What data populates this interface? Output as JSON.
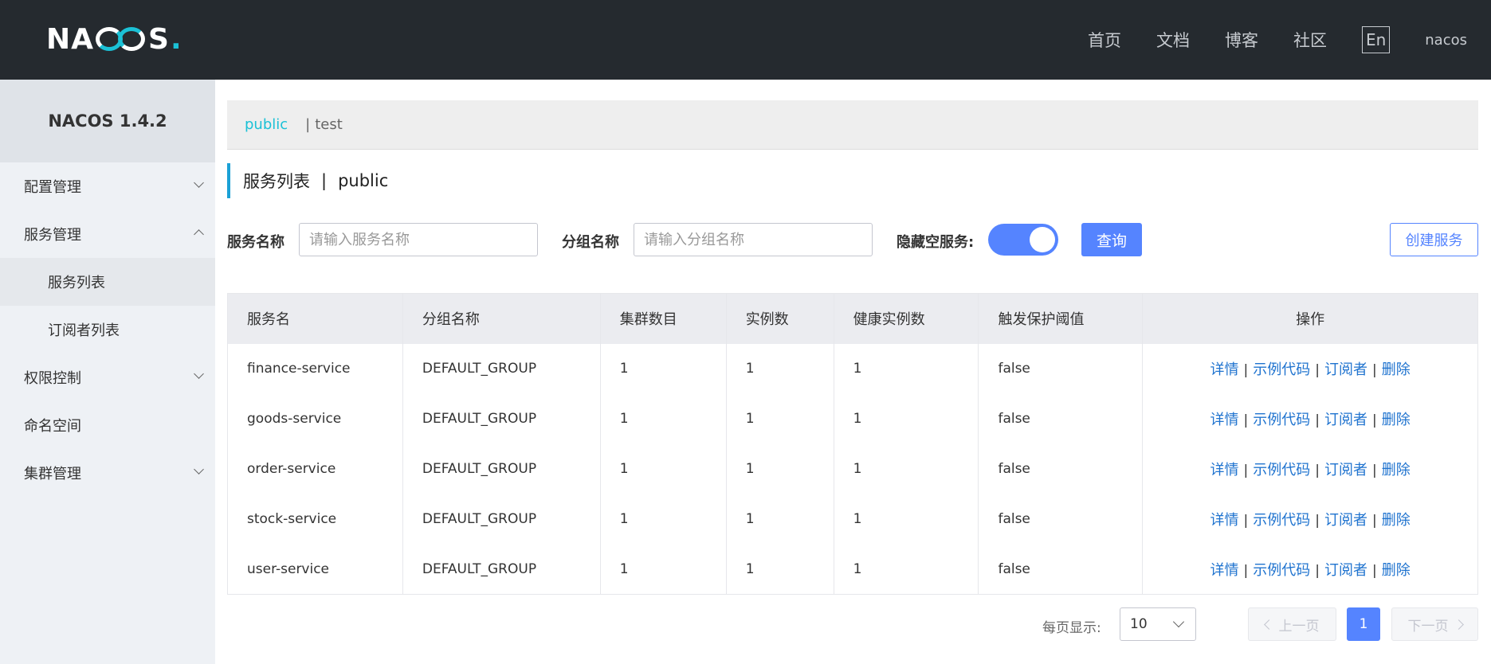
{
  "header": {
    "logo_left": "NA",
    "logo_right": "S",
    "logo_dot": ".",
    "nav": [
      "首页",
      "文档",
      "博客",
      "社区"
    ],
    "lang": "En",
    "user": "nacos"
  },
  "sidebar": {
    "title": "NACOS 1.4.2",
    "items": [
      {
        "label": "配置管理",
        "chevron": "down"
      },
      {
        "label": "服务管理",
        "chevron": "up"
      },
      {
        "label": "服务列表",
        "sub": true,
        "active": true
      },
      {
        "label": "订阅者列表",
        "sub": true
      },
      {
        "label": "权限控制",
        "chevron": "down"
      },
      {
        "label": "命名空间"
      },
      {
        "label": "集群管理",
        "chevron": "down"
      }
    ]
  },
  "namespace": {
    "active": "public",
    "separator": "|",
    "others": [
      "test"
    ]
  },
  "page": {
    "title": "服务列表",
    "separator": "|",
    "namespace": "public"
  },
  "filter": {
    "service_label": "服务名称",
    "service_placeholder": "请输入服务名称",
    "group_label": "分组名称",
    "group_placeholder": "请输入分组名称",
    "hide_empty_label": "隐藏空服务:",
    "hide_empty_on": true,
    "query_button": "查询",
    "create_button": "创建服务"
  },
  "table": {
    "columns": [
      "服务名",
      "分组名称",
      "集群数目",
      "实例数",
      "健康实例数",
      "触发保护阈值",
      "操作"
    ],
    "rows": [
      [
        "finance-service",
        "DEFAULT_GROUP",
        "1",
        "1",
        "1",
        "false"
      ],
      [
        "goods-service",
        "DEFAULT_GROUP",
        "1",
        "1",
        "1",
        "false"
      ],
      [
        "order-service",
        "DEFAULT_GROUP",
        "1",
        "1",
        "1",
        "false"
      ],
      [
        "stock-service",
        "DEFAULT_GROUP",
        "1",
        "1",
        "1",
        "false"
      ],
      [
        "user-service",
        "DEFAULT_GROUP",
        "1",
        "1",
        "1",
        "false"
      ]
    ],
    "actions": [
      "详情",
      "示例代码",
      "订阅者",
      "删除"
    ],
    "action_separator": "|"
  },
  "pagination": {
    "page_size_label": "每页显示:",
    "page_size": "10",
    "prev": "上一页",
    "current": "1",
    "next": "下一页"
  },
  "colors": {
    "topbar": "#252a2f",
    "accent": "#5584ff",
    "namespace_active": "#1bc1d6",
    "link": "#1f73cf"
  }
}
